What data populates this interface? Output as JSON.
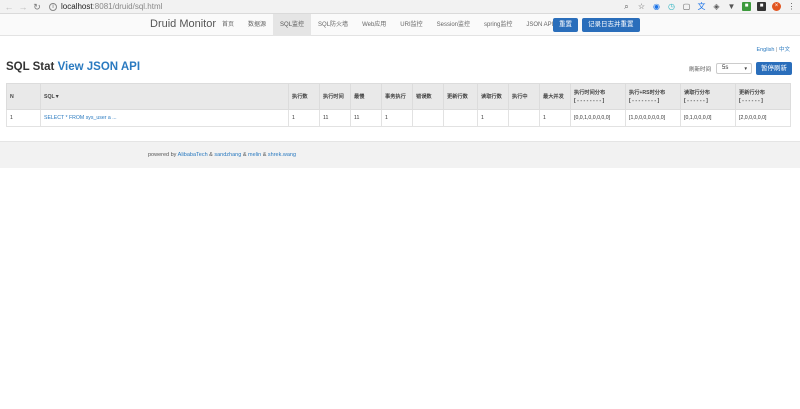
{
  "browser": {
    "url_host": "localhost",
    "url_path": ":8081/druid/sql.html"
  },
  "navbar": {
    "brand": "Druid Monitor",
    "items": [
      {
        "label": "首页"
      },
      {
        "label": "数据源"
      },
      {
        "label": "SQL监控"
      },
      {
        "label": "SQL防火墙"
      },
      {
        "label": "Web应用"
      },
      {
        "label": "URI监控"
      },
      {
        "label": "Session监控"
      },
      {
        "label": "spring监控"
      },
      {
        "label": "JSON API"
      }
    ],
    "active_index": 2,
    "reset_label": "重置",
    "reset_log_label": "记录日志并重置"
  },
  "lang": {
    "english": "English",
    "sep": "|",
    "chinese": "中文"
  },
  "page": {
    "title_prefix": "SQL Stat ",
    "title_link": "View JSON API",
    "refresh_label": "刷新时间",
    "refresh_value": "5s",
    "pause_label": "暂停刷新"
  },
  "table": {
    "headers": [
      "N",
      "SQL▼",
      "执行数",
      "执行时间",
      "最慢",
      "事务执行",
      "错误数",
      "更新行数",
      "读取行数",
      "执行中",
      "最大并发",
      "执行时间分布",
      "执行+RS时分布",
      "读取行分布",
      "更新行分布"
    ],
    "dist_sub": [
      "[ - - - - - - - - ]",
      "[ - - - - - - - - ]",
      "[ - - - - - - ]",
      "[ - - - - - - ]"
    ],
    "rows": [
      [
        "1",
        "SELECT * FROM sys_user a ...",
        "1",
        "11",
        "11",
        "1",
        "",
        "",
        "1",
        "",
        "1",
        "[0,0,1,0,0,0,0,0]",
        "[1,0,0,0,0,0,0,0]",
        "[0,1,0,0,0,0]",
        "[2,0,0,0,0,0]"
      ]
    ]
  },
  "footer": {
    "prefix": "powered by ",
    "link1": "AlibabaTech",
    "amp1": " & ",
    "link2": "sandzhang",
    "amp2": " & ",
    "link3": "melin",
    "amp3": " & ",
    "link4": "shrek.wang"
  }
}
